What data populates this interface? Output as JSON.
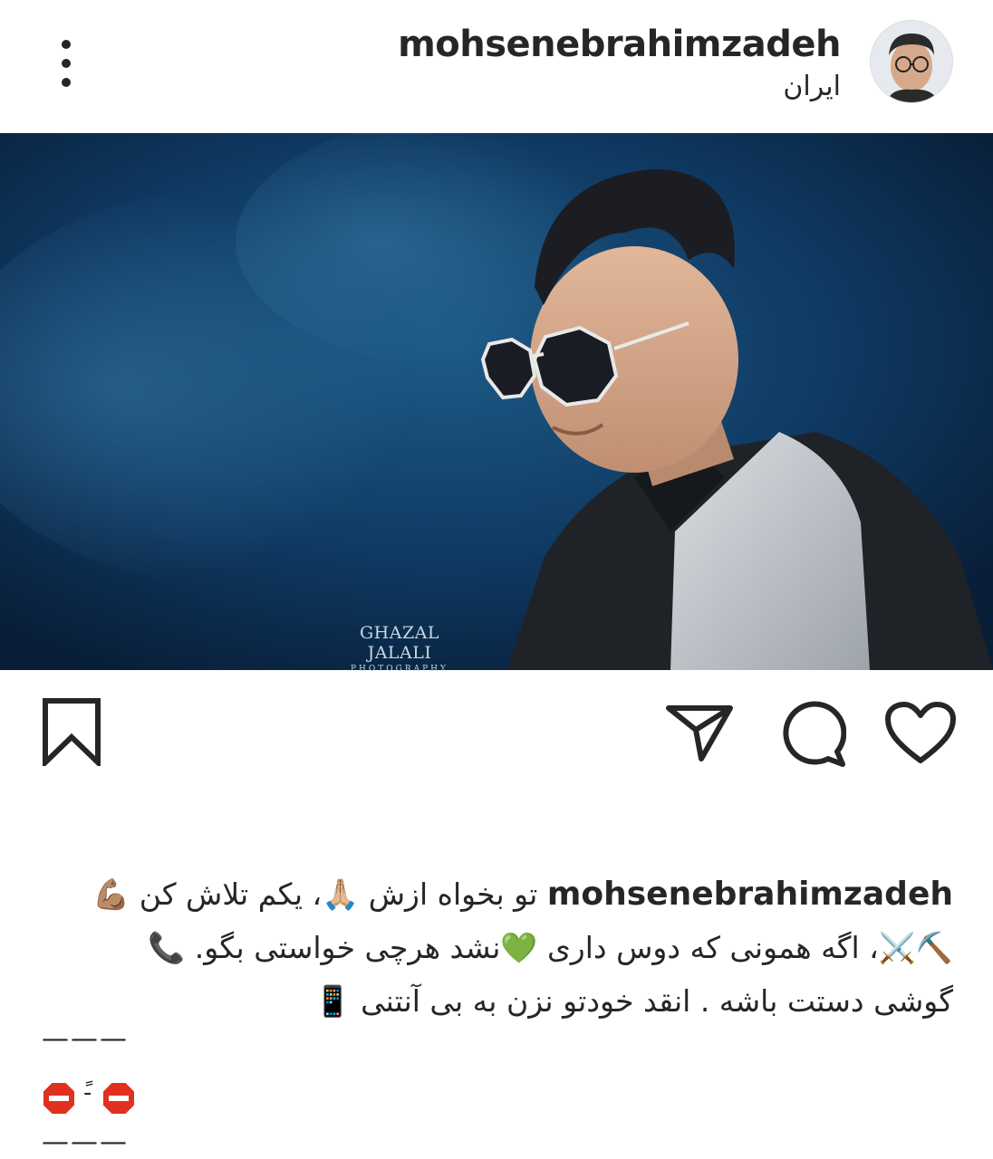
{
  "post": {
    "username": "mohsenebrahimzadeh",
    "location": "ایران",
    "photo_watermark": {
      "line1": "GHAZAL JALALI",
      "line2": "PHOTOGRAPHY"
    }
  },
  "icons": {
    "more": "more-vertical-icon",
    "like": "heart-icon",
    "comment": "comment-icon",
    "share": "send-icon",
    "save": "bookmark-icon"
  },
  "caption": {
    "username": "mohsenebrahimzadeh",
    "line1": "تو بخواه ازش 🙏🏼، یکم تلاش کن 💪🏽",
    "line2": "⛏️⚔️، اگه همونی که دوس داری 💚نشد هرچی خواستی بگو. 📞",
    "line3": "گوشی دستت باشه . انقد خودتو نزن به بی آنتنی 📱",
    "divider": "———",
    "emoji_separator": "-ً"
  },
  "colors": {
    "text": "#262626",
    "stop_sign": "#e0301e",
    "photo_bg": "#0c2a4b"
  }
}
